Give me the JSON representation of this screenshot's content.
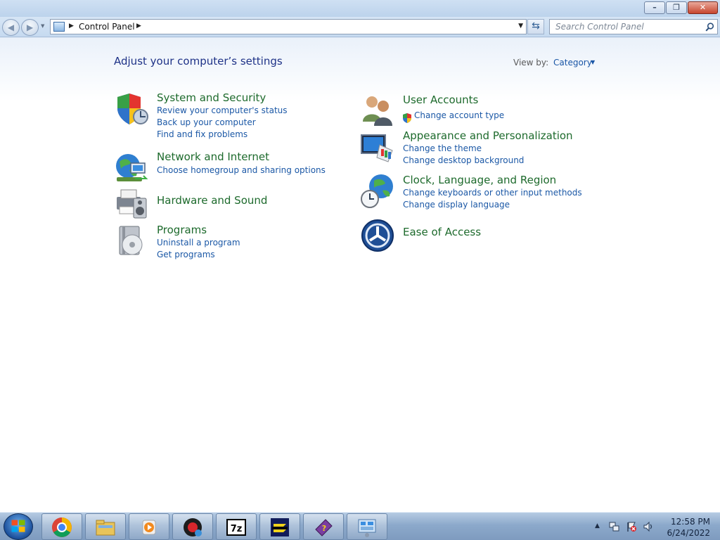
{
  "window": {
    "minimize_icon": "minimize-icon",
    "maximize_icon": "restore-icon",
    "close_icon": "close-icon"
  },
  "navigation": {
    "back_icon": "back-arrow-icon",
    "forward_icon": "forward-arrow-icon",
    "address_path": "Control Panel",
    "refresh_icon": "refresh-icon",
    "search_placeholder": "Search Control Panel"
  },
  "main": {
    "heading": "Adjust your computer’s settings",
    "view_by_label": "View by:",
    "view_by_value": "Category",
    "categories": [
      {
        "title": "System and Security",
        "icon": "shield-icon",
        "links": [
          "Review your computer's status",
          "Back up your computer",
          "Find and fix problems"
        ]
      },
      {
        "title": "Network and Internet",
        "icon": "network-globe-icon",
        "links": [
          "Choose homegroup and sharing options"
        ]
      },
      {
        "title": "Hardware and Sound",
        "icon": "printer-speaker-icon",
        "links": []
      },
      {
        "title": "Programs",
        "icon": "programs-disc-icon",
        "links": [
          "Uninstall a program",
          "Get programs"
        ]
      },
      {
        "title": "User Accounts",
        "icon": "users-icon",
        "links": [
          "Change account type"
        ]
      },
      {
        "title": "Appearance and Personalization",
        "icon": "monitor-palette-icon",
        "links": [
          "Change the theme",
          "Change desktop background"
        ]
      },
      {
        "title": "Clock, Language, and Region",
        "icon": "clock-globe-icon",
        "links": [
          "Change keyboards or other input methods",
          "Change display language"
        ]
      },
      {
        "title": "Ease of Access",
        "icon": "ease-of-access-icon",
        "links": []
      }
    ]
  },
  "taskbar": {
    "pinned": [
      "chrome-icon",
      "file-explorer-icon",
      "media-player-icon",
      "recorder-icon",
      "7zip-icon",
      "app-icon",
      "help-book-icon",
      "control-panel-icon"
    ],
    "clock_time": "12:58 PM",
    "clock_date": "6/24/2022"
  }
}
